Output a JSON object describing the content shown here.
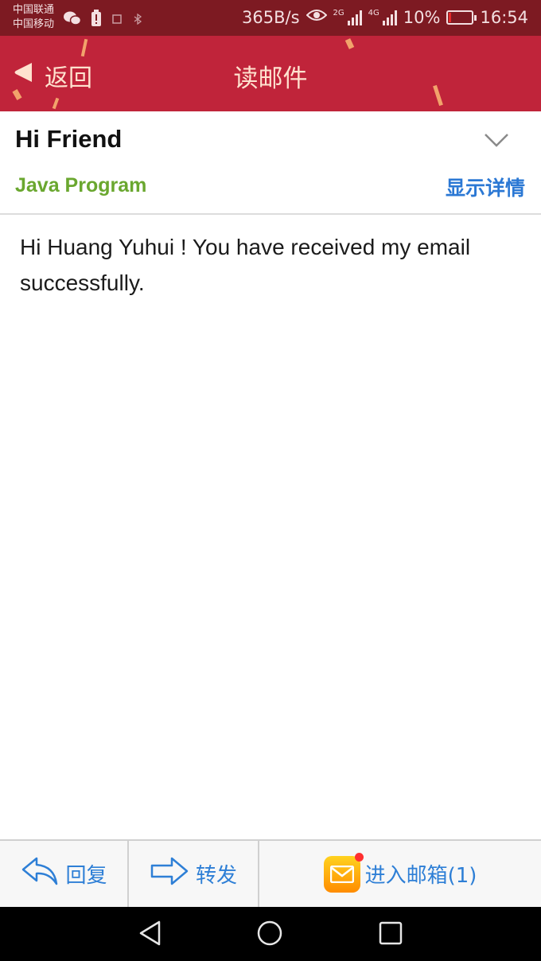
{
  "status_bar": {
    "carrier_1": "中国联通",
    "carrier_2": "中国移动",
    "net_speed": "365B/s",
    "sim1_type": "2G",
    "sim2_type": "4G",
    "battery_percent": "10%",
    "battery_level": 0.1,
    "time": "16:54",
    "icons": [
      "wechat-icon",
      "battery-saver-icon",
      "screenshot-icon",
      "bluetooth-icon",
      "eye-icon",
      "signal-icon"
    ]
  },
  "title_bar": {
    "back_label": "返回",
    "title": "读邮件"
  },
  "email": {
    "subject": "Hi Friend",
    "sender": "Java Program",
    "details_link": "显示详情",
    "body": "Hi Huang Yuhui ! You have received my email successfully."
  },
  "action_bar": {
    "reply_label": "回复",
    "forward_label": "转发",
    "mailbox_label": "进入邮箱(1)"
  },
  "nav_bar": {
    "buttons": [
      "back-icon",
      "home-icon",
      "recents-icon"
    ]
  },
  "colors": {
    "status_bar_bg": "#7d1a22",
    "title_bar_bg": "#c0243a",
    "sender": "#6aa72f",
    "link": "#2b78d4",
    "action": "#2e7fd6"
  }
}
